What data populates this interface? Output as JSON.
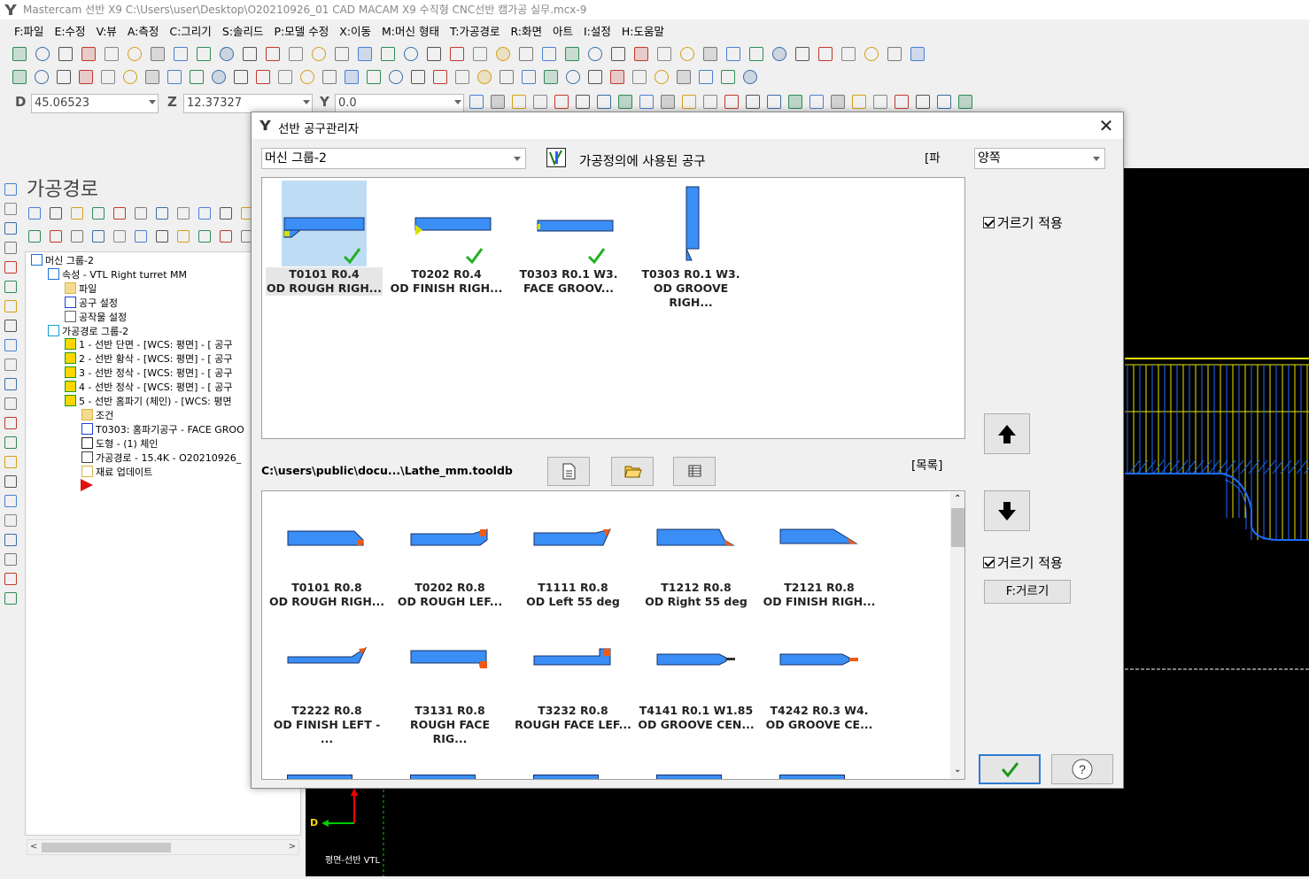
{
  "window": {
    "title": "Mastercam 선반 X9   C:\\Users\\user\\Desktop\\O20210926_01 CAD MACAM X9 수직형 CNC선반 캠가공 실무.mcx-9"
  },
  "menu": [
    "F:파일",
    "E:수정",
    "V:뷰",
    "A:측정",
    "C:그리기",
    "S:솔리드",
    "P:모델 수정",
    "X:이동",
    "M:머신 형태",
    "T:가공경로",
    "R:화면",
    "아트",
    "I:설정",
    "H:도움말"
  ],
  "coords": {
    "d_label": "D",
    "d_value": "45.06523",
    "z_label": "Z",
    "z_value": "12.37327",
    "y_label": "Y",
    "y_value": "0.0"
  },
  "ops_panel": {
    "title": "가공경로",
    "tree": [
      {
        "text": "머신 그룹-2",
        "icon": "machine-group-icon"
      },
      {
        "text": "속성 - VTL Right turret MM",
        "icon": "properties-icon"
      },
      {
        "text": "파일",
        "icon": "folder-icon"
      },
      {
        "text": "공구 설정",
        "icon": "tool-settings-icon"
      },
      {
        "text": "공작물 설정",
        "icon": "stock-settings-icon"
      },
      {
        "text": "가공경로 그룹-2",
        "icon": "toolpath-group-icon"
      },
      {
        "text": "1 - 선반 단면 - [WCS: 평면] - [ 공구",
        "icon": "operation-icon"
      },
      {
        "text": "2 - 선반 황삭 - [WCS: 평면] - [ 공구",
        "icon": "operation-icon"
      },
      {
        "text": "3 - 선반 정삭 - [WCS: 평면] - [ 공구",
        "icon": "operation-icon"
      },
      {
        "text": "4 - 선반 정삭 - [WCS: 평면] - [ 공구",
        "icon": "operation-icon"
      },
      {
        "text": "5 - 선반 홈파기 (체인) - [WCS: 평면",
        "icon": "operation-open-icon"
      },
      {
        "text": "조건",
        "icon": "folder-icon"
      },
      {
        "text": "T0303: 홈파기공구 - FACE GROO",
        "icon": "tool-icon"
      },
      {
        "text": "도형 - (1) 체인",
        "icon": "geometry-icon"
      },
      {
        "text": "가공경로 - 15.4K - O20210926_",
        "icon": "toolpath-icon"
      },
      {
        "text": "재료 업데이트",
        "icon": "stock-update-icon"
      }
    ]
  },
  "graphics": {
    "axis_label": "D",
    "view_label": "평면-선반 VTL",
    "axis_color": "#ff0000",
    "axis2_color": "#00cc00"
  },
  "dialog": {
    "title": "선반 공구관리자",
    "machine_group": "머신 그룹-2",
    "used_tools_label": "가공정의에 사용된 공구",
    "bracket_text": "[파",
    "side_select": "양쪽",
    "filter_label": "거르기 적용",
    "filter_label_2": "거르기 적용",
    "filter_button": "F:거르기",
    "library_path": "C:\\users\\public\\docu...\\Lathe_mm.tooldb",
    "list_label": "[목록]",
    "ok_icon": "check-icon",
    "help_icon": "question-icon",
    "used_tools": [
      {
        "line1": "T0101 R0.4",
        "line2": "OD ROUGH RIGH...",
        "selected": true,
        "checked": true
      },
      {
        "line1": "T0202 R0.4",
        "line2": "OD FINISH RIGH...",
        "selected": false,
        "checked": true
      },
      {
        "line1": "T0303 R0.1 W3.",
        "line2": "FACE GROOV...",
        "selected": false,
        "checked": true
      },
      {
        "line1": "T0303 R0.1 W3.",
        "line2": "OD GROOVE RIGH...",
        "selected": false,
        "checked": false
      }
    ],
    "library_tools": [
      {
        "line1": "T0101 R0.8",
        "line2": "OD ROUGH RIGH..."
      },
      {
        "line1": "T0202 R0.8",
        "line2": "OD ROUGH LEF..."
      },
      {
        "line1": "T1111 R0.8",
        "line2": "OD Left 55 deg"
      },
      {
        "line1": "T1212 R0.8",
        "line2": "OD Right 55 deg"
      },
      {
        "line1": "T2121 R0.8",
        "line2": "OD FINISH RIGH..."
      },
      {
        "line1": "T2222 R0.8",
        "line2": "OD FINISH LEFT - ..."
      },
      {
        "line1": "T3131 R0.8",
        "line2": "ROUGH FACE RIG..."
      },
      {
        "line1": "T3232 R0.8",
        "line2": "ROUGH FACE LEF..."
      },
      {
        "line1": "T4141 R0.1 W1.85",
        "line2": "OD GROOVE CEN..."
      },
      {
        "line1": "T4242 R0.3 W4.",
        "line2": "OD GROOVE CE..."
      }
    ]
  }
}
